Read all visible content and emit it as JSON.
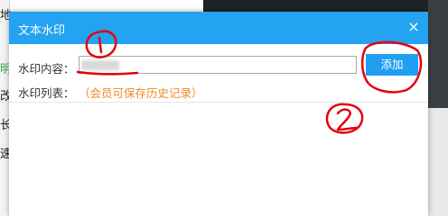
{
  "background": {
    "left_chars": [
      "地",
      "明",
      "改",
      "长",
      "速"
    ],
    "left_char_colors": [
      "#222222",
      "#2aa84a",
      "#222222",
      "#222222",
      "#222222"
    ]
  },
  "dialog": {
    "title": "文本水印",
    "close_icon": "×",
    "content_label": "水印内容：",
    "content_value": "",
    "add_button_label": "添加",
    "list_label": "水印列表：",
    "list_hint": "（会员可保存历史记录）",
    "colors": {
      "titlebar": "#24a3f2",
      "button": "#1e9ff2",
      "hint": "#f08a2b"
    }
  },
  "annotations": {
    "marker_1": "①",
    "marker_2": "②",
    "color": "#e3000b"
  }
}
